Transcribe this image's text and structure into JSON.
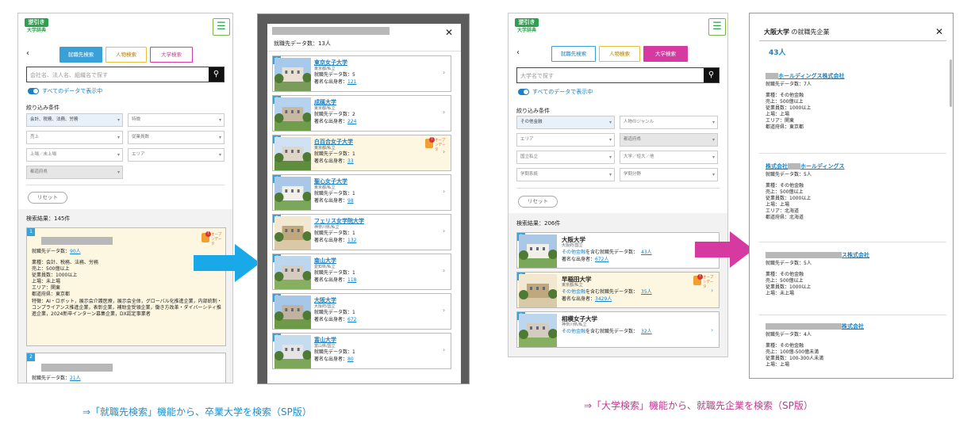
{
  "colors": {
    "blue_arrow": "#1aa9e8",
    "pink_arrow": "#d63aa0",
    "accent_blue": "#3aa0d8",
    "accent_pink": "#d63aa0",
    "logo_green": "#2e9e4f"
  },
  "common": {
    "logo_top": "逆引き",
    "logo_bottom": "大学辞典",
    "menu_icon": "hamburger-icon",
    "back": "‹",
    "tab_job": "就職先検索",
    "tab_person": "人物検索",
    "tab_univ": "大学検索",
    "toggle_label": "すべてのデータで表示中",
    "filter_title": "絞り込み条件",
    "reset": "リセット",
    "open_data": "オープンデータ",
    "open_badge_num": "!",
    "chevron": "›",
    "close": "✕"
  },
  "panel1": {
    "search_placeholder": "会社名、法人名、組織名で探す",
    "filters": [
      "会計、税務、法務、労務",
      "特徴",
      "売上",
      "従業員数",
      "上場／未上場",
      "エリア",
      "都道府県"
    ],
    "result_count": "検索結果：145件",
    "card1": {
      "num": "1",
      "data_count_label": "就職先データ数：",
      "data_count_value": "90人",
      "lines": [
        "業種：会計、税務、法務、労務",
        "売上：500億以上",
        "従業員数：1000以上",
        "上場：未上場",
        "エリア：関東",
        "都道府県：東京都"
      ],
      "feature": "特徴：AI・ロボット，展示会介護医療，展示会全体，グローバル化推進企業，内部統制・コンプライアンス推進企業，表彰企業，補助金受領企業，働き方改革・ダイバーシティ推進企業，2024新卒インターン募集企業，DX認定事業者"
    },
    "card2": {
      "num": "2",
      "data_count_label": "就職先データ数：",
      "data_count_value": "21人"
    }
  },
  "panel2": {
    "header_count": "就職先データ数：13人",
    "universities": [
      {
        "num": "1",
        "name": "東京女子大学",
        "loc": "東京都/私立",
        "count": "就職先データ数：5",
        "famous_label": "著名な出身者：",
        "famous": "121"
      },
      {
        "num": "2",
        "name": "成蹊大学",
        "loc": "東京都/私立",
        "count": "就職先データ数：2",
        "famous_label": "著名な出身者：",
        "famous": "224"
      },
      {
        "num": "3",
        "name": "白百合女子大学",
        "loc": "東京都/私立",
        "count": "就職先データ数：1",
        "famous_label": "著名な出身者：",
        "famous": "33"
      },
      {
        "num": "4",
        "name": "聖心女子大学",
        "loc": "東京都/私立",
        "count": "就職先データ数：1",
        "famous_label": "著名な出身者：",
        "famous": "98"
      },
      {
        "num": "5",
        "name": "フェリス女学院大学",
        "loc": "神奈川県/私立",
        "count": "就職先データ数：1",
        "famous_label": "著名な出身者：",
        "famous": "132"
      },
      {
        "num": "6",
        "name": "南山大学",
        "loc": "愛知県/私立",
        "count": "就職先データ数：1",
        "famous_label": "著名な出身者：",
        "famous": "118"
      },
      {
        "num": "7",
        "name": "大阪大学",
        "loc": "大阪府/国立",
        "count": "就職先データ数：1",
        "famous_label": "著名な出身者：",
        "famous": "672"
      },
      {
        "num": "8",
        "name": "富山大学",
        "loc": "富山県/国立",
        "count": "就職先データ数：1",
        "famous_label": "著名な出身者：",
        "famous": "80"
      }
    ]
  },
  "panel3": {
    "search_placeholder": "大学名で探す",
    "filters": [
      "その他金融",
      "人物のジャンル",
      "エリア",
      "都道府県",
      "国立私立",
      "大学／短大／他",
      "学問系統",
      "学問分野"
    ],
    "result_count": "検索結果：206件",
    "universities": [
      {
        "num": "1",
        "name": "大阪大学",
        "loc": "大阪府/国立",
        "line_pre": "その他金融",
        "line_mid": "を含む就職先データ数：",
        "line_val": "43人",
        "famous_label": "著名な出身者：",
        "famous": "672人"
      },
      {
        "num": "2",
        "name": "早稲田大学",
        "loc": "東京都/私立",
        "line_pre": "その他金融",
        "line_mid": "を含む就職先データ数：",
        "line_val": "35人",
        "famous_label": "著名な出身者：",
        "famous": "3429人"
      },
      {
        "num": "3",
        "name": "相模女子大学",
        "loc": "神奈川県/私立",
        "line_pre": "その他金融",
        "line_mid": "を含む就職先データ数：",
        "line_val": "32人"
      }
    ]
  },
  "panel4": {
    "title_bold": "大阪大学",
    "title_rest": " の就職先企業",
    "count": "43人",
    "companies": [
      {
        "name_suffix": "ホールディングス株式会社",
        "count": "就職先データ数：7人",
        "lines": [
          "業種：その他金融",
          "売上：500億以上",
          "従業員数：1000以上",
          "上場：上場",
          "エリア：関東",
          "都道府県：東京都"
        ]
      },
      {
        "name_prefix": "株式会社",
        "name_suffix": "ホールディングス",
        "count": "就職先データ数：5人",
        "lines": [
          "業種：その他金融",
          "売上：500億以上",
          "従業員数：1000以上",
          "上場：上場",
          "エリア：北海道",
          "都道府県：北海道"
        ]
      },
      {
        "name_suffix": "ス株式会社",
        "count": "就職先データ数：5人",
        "lines": [
          "業種：その他金融",
          "売上：500億以上",
          "従業員数：1000以上",
          "上場：未上場"
        ]
      },
      {
        "name_suffix": "株式会社",
        "count": "就職先データ数：4人",
        "lines": [
          "業種：その他金融",
          "売上：100億-500億未満",
          "従業員数：100-300人未満",
          "上場：上場"
        ]
      }
    ]
  },
  "captions": {
    "left": "⇒「就職先検索」機能から、卒業大学を検索（SP版）",
    "right": "⇒「大学検索」機能から、就職先企業を検索（SP版）"
  }
}
